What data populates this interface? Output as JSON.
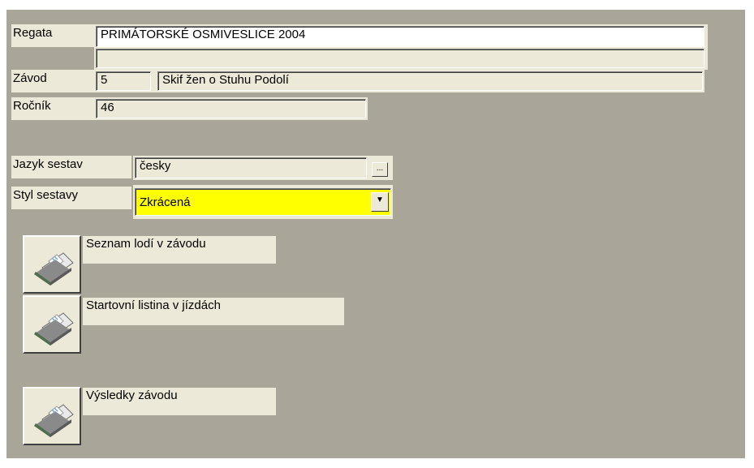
{
  "regata": {
    "label": "Regata",
    "value": "PRIMÁTORSKÉ OSMIVESLICE 2004",
    "value2": ""
  },
  "zavod": {
    "label": "Závod",
    "number": "5",
    "name": "Skif žen o Stuhu Podolí"
  },
  "rocnik": {
    "label": "Ročník",
    "value": "46"
  },
  "jazyk": {
    "label": "Jazyk sestav",
    "value": "česky",
    "browse_label": "..."
  },
  "styl": {
    "label": "Styl sestavy",
    "value": "Zkrácená"
  },
  "reports": [
    {
      "label": "Seznam lodí v závodu",
      "icon": "printer-icon"
    },
    {
      "label": "Startovní listina v jízdách",
      "icon": "printer-icon"
    },
    {
      "label": "Výsledky závodu",
      "icon": "printer-icon"
    }
  ],
  "colors": {
    "form_bg": "#a9a598",
    "control_bg": "#ece9d8",
    "highlight": "#ffff00"
  }
}
